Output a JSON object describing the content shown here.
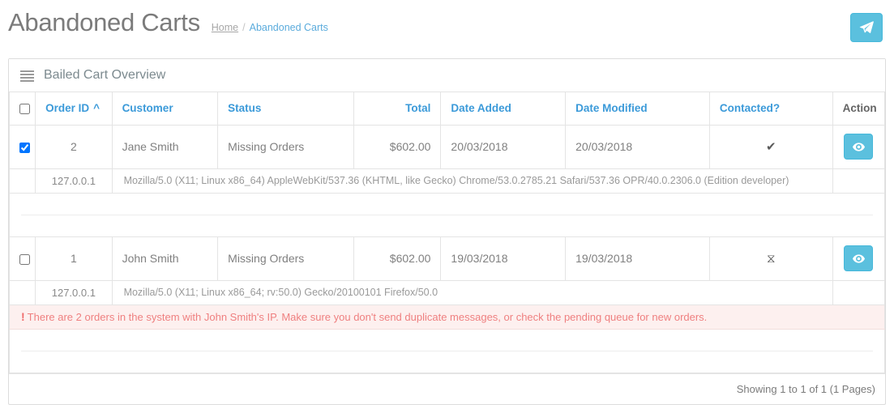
{
  "header": {
    "title": "Abandoned Carts",
    "breadcrumb": {
      "home": "Home",
      "separator": "/",
      "current": "Abandoned Carts"
    },
    "send_button_icon": "paper-plane-icon",
    "accent_color": "#5bc0de"
  },
  "panel": {
    "icon": "list-icon",
    "title": "Bailed Cart Overview",
    "columns": [
      {
        "key": "select",
        "label": "",
        "align": "center",
        "sortable": false
      },
      {
        "key": "order_id",
        "label": "Order ID",
        "align": "left",
        "sortable": true,
        "sort": "asc",
        "sort_caret": "^"
      },
      {
        "key": "customer",
        "label": "Customer",
        "align": "left",
        "sortable": true
      },
      {
        "key": "status",
        "label": "Status",
        "align": "left",
        "sortable": true
      },
      {
        "key": "total",
        "label": "Total",
        "align": "right",
        "sortable": true
      },
      {
        "key": "date_added",
        "label": "Date Added",
        "align": "left",
        "sortable": true
      },
      {
        "key": "date_modified",
        "label": "Date Modified",
        "align": "left",
        "sortable": true
      },
      {
        "key": "contacted",
        "label": "Contacted?",
        "align": "center",
        "sortable": true
      },
      {
        "key": "action",
        "label": "Action",
        "align": "center",
        "sortable": false
      }
    ],
    "select_all_checked": false,
    "rows": [
      {
        "selected": true,
        "order_id": "2",
        "customer": "Jane Smith",
        "status": "Missing Orders",
        "total": "$602.00",
        "date_added": "20/03/2018",
        "date_modified": "20/03/2018",
        "contacted": "✔",
        "contacted_icon": "check-icon",
        "action_icon": "eye-icon",
        "ip": "127.0.0.1",
        "user_agent": "Mozilla/5.0 (X11; Linux x86_64) AppleWebKit/537.36 (KHTML, like Gecko) Chrome/53.0.2785.21 Safari/537.36 OPR/40.0.2306.0 (Edition developer)"
      },
      {
        "selected": false,
        "order_id": "1",
        "customer": "John Smith",
        "status": "Missing Orders",
        "total": "$602.00",
        "date_added": "19/03/2018",
        "date_modified": "19/03/2018",
        "contacted": "⧖",
        "contacted_icon": "hourglass-icon",
        "action_icon": "eye-icon",
        "ip": "127.0.0.1",
        "user_agent": "Mozilla/5.0 (X11; Linux x86_64; rv:50.0) Gecko/20100101 Firefox/50.0"
      }
    ],
    "alert": {
      "icon": "exclamation-icon",
      "bang": "!",
      "text": "There are 2 orders in the system with John Smith's IP. Make sure you don't send duplicate messages, or check the pending queue for new orders.",
      "background_color": "#fdf0ef",
      "text_color": "#ef8080"
    },
    "footer": {
      "pager_text": "Showing 1 to 1 of 1 (1 Pages)"
    }
  }
}
